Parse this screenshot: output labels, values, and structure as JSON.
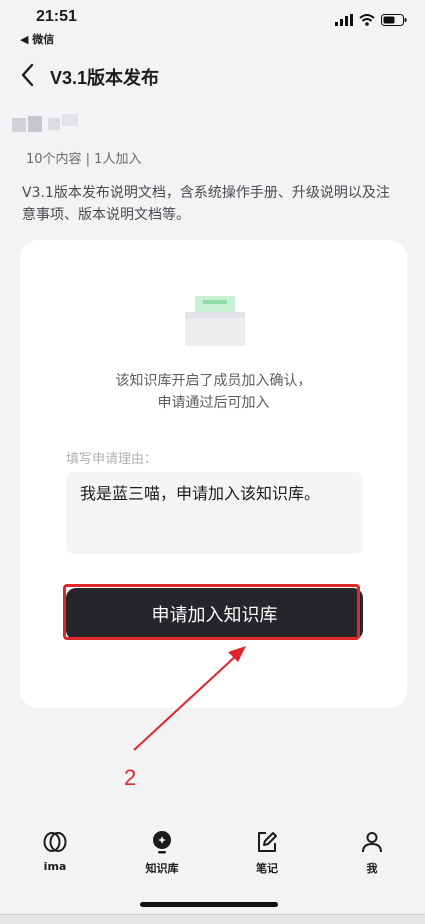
{
  "status": {
    "time": "21:51",
    "back_app": "◀ 微信"
  },
  "nav": {
    "title": "V3.1版本发布"
  },
  "kb": {
    "meta": "10个内容 | 1人加入",
    "description": "V3.1版本发布说明文档，含系统操作手册、升级说明以及注意事项、版本说明文档等。"
  },
  "card": {
    "notice_line1": "该知识库开启了成员加入确认，",
    "notice_line2": "申请通过后可加入",
    "reason_label": "填写申请理由：",
    "reason_value": "我是蓝三喵，申请加入该知识库。",
    "join_button": "申请加入知识库"
  },
  "annotation": {
    "step": "2",
    "color": "#e0262a"
  },
  "tabs": [
    {
      "label": "ima",
      "icon": "ima-logo-icon"
    },
    {
      "label": "知识库",
      "icon": "knowledge-base-icon"
    },
    {
      "label": "笔记",
      "icon": "note-edit-icon"
    },
    {
      "label": "我",
      "icon": "profile-icon"
    }
  ]
}
